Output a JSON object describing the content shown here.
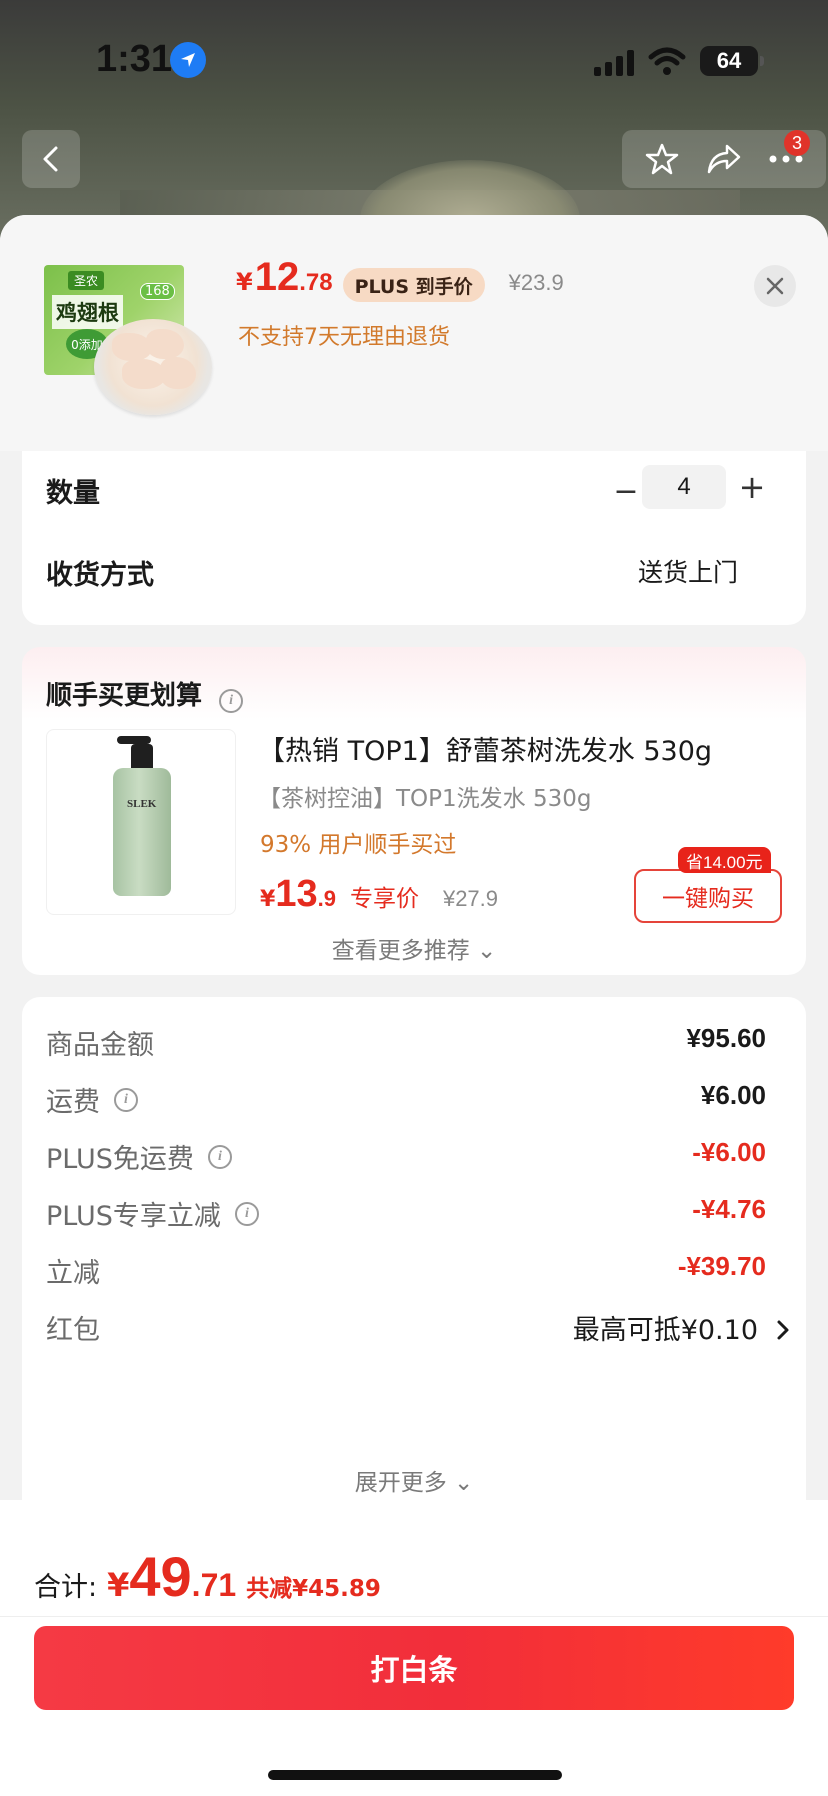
{
  "status_bar": {
    "time": "1:31",
    "battery": "64"
  },
  "background_page": {
    "cart_badge": "3"
  },
  "product": {
    "thumb_name": "鸡翅根",
    "thumb_brand": "圣农",
    "thumb_badge": "168",
    "thumb_tag": "0添加",
    "price_symbol": "¥",
    "price_int": "12",
    "price_dec": ".78",
    "plus_badge": "PLUS 到手价",
    "original_price": "¥23.9",
    "return_note": "不支持7天无理由退货"
  },
  "options": {
    "quantity_label": "数量",
    "quantity_value": "4",
    "minus": "−",
    "plus": "+",
    "delivery_label": "收货方式",
    "delivery_value": "送货上门"
  },
  "recommend": {
    "title": "顺手买更划算",
    "item": {
      "name": "【热销 TOP1】舒蕾茶树洗发水 530g",
      "subtitle": "【茶树控油】TOP1洗发水 530g",
      "hot": "93% 用户顺手买过",
      "price_symbol": "¥",
      "price_int": "13",
      "price_dec": ".9",
      "price_tag": "专享价",
      "original_price": "¥27.9",
      "save_tag": "省14.00元",
      "buy_button": "一键购买",
      "bottle_label": "SLEK"
    },
    "more": "查看更多推荐 ⌄"
  },
  "price_detail": {
    "rows": [
      {
        "label": "商品金额",
        "value": "¥95.60",
        "info": false,
        "color": "black"
      },
      {
        "label": "运费",
        "value": "¥6.00",
        "info": true,
        "color": "black"
      },
      {
        "label": "PLUS免运费",
        "value": "-¥6.00",
        "info": true,
        "color": "red"
      },
      {
        "label": "PLUS专享立减",
        "value": "-¥4.76",
        "info": true,
        "color": "red"
      },
      {
        "label": "立减",
        "value": "-¥39.70",
        "info": false,
        "color": "red"
      },
      {
        "label": "红包",
        "value": "最高可抵¥0.10",
        "info": false,
        "color": "plain"
      }
    ],
    "expand": "展开更多 ⌄"
  },
  "footer": {
    "total_label": "合计:",
    "total_symbol": "¥",
    "total_int": "49",
    "total_dec": ".71",
    "total_save": "共减¥45.89",
    "pay_button": "打白条"
  },
  "colors": {
    "accent_red": "#e52b1e",
    "orange_note": "#d27a2c",
    "plus_badge_bg": "#f7dac4"
  }
}
